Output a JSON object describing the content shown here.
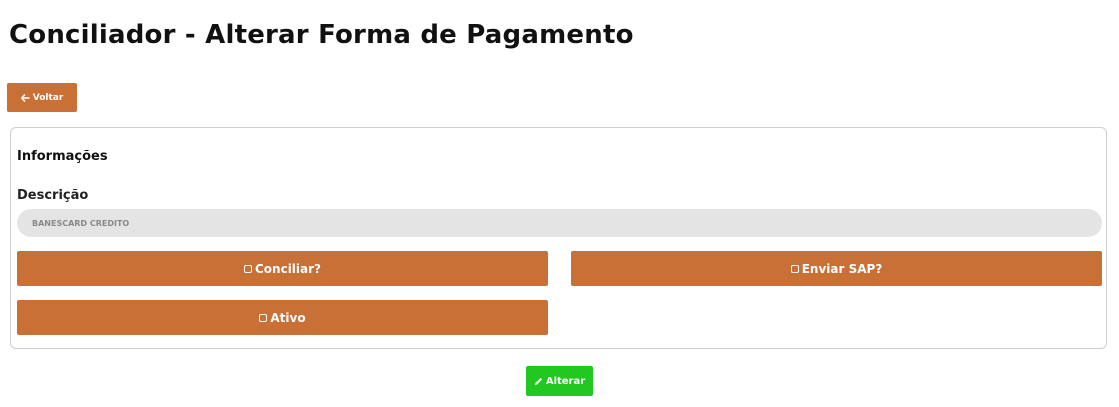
{
  "page": {
    "title": "Conciliador - Alterar Forma de Pagamento"
  },
  "back_button": {
    "icon": "arrow-left-icon",
    "label": "Voltar"
  },
  "info_panel": {
    "section_title": "Informações",
    "description": {
      "label": "Descrição",
      "value": "BANESCARD CREDITO"
    },
    "toggles": {
      "conciliar": {
        "icon": "checkbox-unchecked-icon",
        "label": "Conciliar?",
        "checked": false
      },
      "enviar_sap": {
        "icon": "checkbox-unchecked-icon",
        "label": "Enviar SAP?",
        "checked": false
      },
      "ativo": {
        "icon": "checkbox-unchecked-icon",
        "label": "Ativo",
        "checked": false
      }
    }
  },
  "submit_button": {
    "icon": "pencil-icon",
    "label": "Alterar"
  },
  "colors": {
    "primary": "#c87035",
    "success": "#22c722",
    "input_bg": "#e4e4e4"
  }
}
